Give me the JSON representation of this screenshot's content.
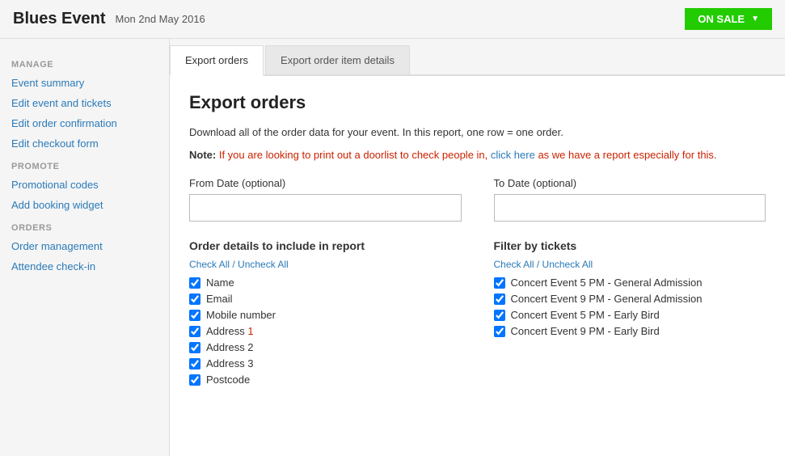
{
  "header": {
    "title": "Blues Event",
    "date": "Mon 2nd May 2016",
    "status_button": "ON SALE"
  },
  "sidebar": {
    "manage_label": "MANAGE",
    "manage_links": [
      {
        "label": "Event summary",
        "name": "event-summary"
      },
      {
        "label": "Edit event and tickets",
        "name": "edit-event-tickets"
      },
      {
        "label": "Edit order confirmation",
        "name": "edit-order-confirmation"
      },
      {
        "label": "Edit checkout form",
        "name": "edit-checkout-form"
      }
    ],
    "promote_label": "PROMOTE",
    "promote_links": [
      {
        "label": "Promotional codes",
        "name": "promotional-codes"
      },
      {
        "label": "Add booking widget",
        "name": "add-booking-widget"
      }
    ],
    "orders_label": "ORDERS",
    "orders_links": [
      {
        "label": "Order management",
        "name": "order-management"
      },
      {
        "label": "Attendee check-in",
        "name": "attendee-check-in"
      }
    ]
  },
  "tabs": [
    {
      "label": "Export orders",
      "active": true,
      "name": "tab-export-orders"
    },
    {
      "label": "Export order item details",
      "active": false,
      "name": "tab-export-order-items"
    }
  ],
  "content": {
    "title": "Export orders",
    "info_line": "Download all of the order data for your event. In this report, one row = one order.",
    "note_prefix": "Note:",
    "note_body": " If you are looking to print out a doorlist to check people in, ",
    "note_link": "click here",
    "note_suffix": " as we have a report especially for this.",
    "from_date_label": "From Date (optional)",
    "from_date_placeholder": "",
    "to_date_label": "To Date (optional)",
    "to_date_placeholder": "",
    "order_details_title": "Order details to include in report",
    "order_check_all": "Check All / Uncheck All",
    "order_checkboxes": [
      {
        "label": "Name",
        "checked": true
      },
      {
        "label": "Email",
        "checked": true
      },
      {
        "label": "Mobile number",
        "checked": true
      },
      {
        "label": "Address 1",
        "checked": true,
        "red": true
      },
      {
        "label": "Address 2",
        "checked": true
      },
      {
        "label": "Address 3",
        "checked": true
      },
      {
        "label": "Postcode",
        "checked": true
      }
    ],
    "filter_tickets_title": "Filter by tickets",
    "filter_check_all": "Check All / Uncheck All",
    "filter_checkboxes": [
      {
        "label": "Concert Event 5 PM - General Admission",
        "checked": true
      },
      {
        "label": "Concert Event 9 PM - General Admission",
        "checked": true
      },
      {
        "label": "Concert Event 5 PM - Early Bird",
        "checked": true
      },
      {
        "label": "Concert Event 9 PM - Early Bird",
        "checked": true
      }
    ]
  }
}
